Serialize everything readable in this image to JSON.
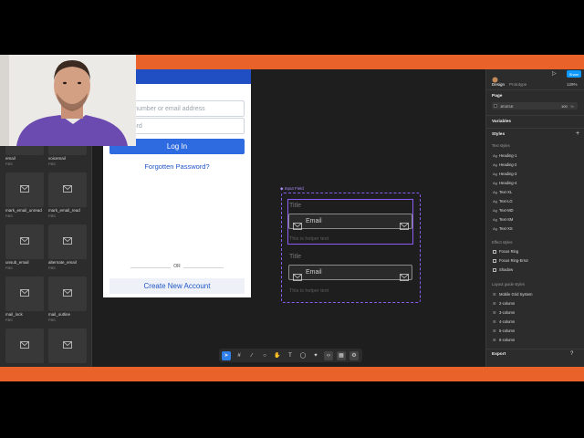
{
  "left_panel": {
    "tiles": [
      {
        "label": "email",
        "sub": "FBS",
        "icon": "mail-icon"
      },
      {
        "label": "voicemail",
        "sub": "FBS",
        "icon": "voicemail-icon"
      },
      {
        "label": "",
        "sub": "",
        "icon": "mail-icon"
      },
      {
        "label": "",
        "sub": "",
        "icon": "mail-icon"
      },
      {
        "label": "mark_email_unread",
        "sub": "FBS",
        "icon": "mail-unread-icon"
      },
      {
        "label": "mark_email_read",
        "sub": "FBS",
        "icon": "mail-read-icon"
      },
      {
        "label": "",
        "sub": "",
        "icon": "mail-icon"
      },
      {
        "label": "",
        "sub": "",
        "icon": "at-icon"
      },
      {
        "label": "unsub_email",
        "sub": "FBS",
        "icon": "mail-icon"
      },
      {
        "label": "alternate_email",
        "sub": "FBS",
        "icon": "at-icon"
      },
      {
        "label": "",
        "sub": "",
        "icon": "mail-lock-icon"
      },
      {
        "label": "",
        "sub": "",
        "icon": "mail-outline-icon"
      },
      {
        "label": "mail_lock",
        "sub": "FBS",
        "icon": "mail-lock-icon"
      },
      {
        "label": "mail_outline",
        "sub": "FBS",
        "icon": "mail-outline-icon"
      },
      {
        "label": "",
        "sub": "",
        "icon": "mail-icon"
      },
      {
        "label": "",
        "sub": "",
        "icon": "pin-icon"
      }
    ]
  },
  "phone": {
    "username_placeholder": "Phone number or email address",
    "password_placeholder": "Password",
    "login_label": "Log In",
    "forgot_label": "Forgotten Password?",
    "or_label": "OR",
    "create_label": "Create New Account"
  },
  "component": {
    "name": "Input Field",
    "fields": [
      {
        "title": "Title",
        "value": "Email",
        "helper": "This is helper text"
      },
      {
        "title": "Title",
        "value": "Email",
        "helper": "This is helper text"
      }
    ]
  },
  "right_panel": {
    "tabs": [
      "Design",
      "Prototype"
    ],
    "zoom": "129%",
    "share": "Share",
    "page_label": "Page",
    "page_color": "1E1E1E",
    "page_opacity": "100",
    "variables_label": "Variables",
    "styles_label": "Styles",
    "text_styles_label": "Text styles",
    "text_styles": [
      "Heading-1",
      "Heading-2",
      "Heading-3",
      "Heading-4",
      "Text-XL",
      "Text-LG",
      "Text-MD",
      "Text-SM",
      "Text-XS"
    ],
    "effect_styles_label": "Effect styles",
    "effect_styles": [
      "Focus Ring",
      "Focus Ring-Error",
      "Shadow"
    ],
    "grid_styles_label": "Layout guide styles",
    "grid_styles": [
      "Mobile Grid System",
      "2-column",
      "3-column",
      "4-column",
      "5-column",
      "6-column"
    ],
    "export_label": "Export"
  },
  "colors": {
    "accent": "#8b5cf6",
    "orange": "#e8622a",
    "primary_blue": "#2f6be0"
  }
}
